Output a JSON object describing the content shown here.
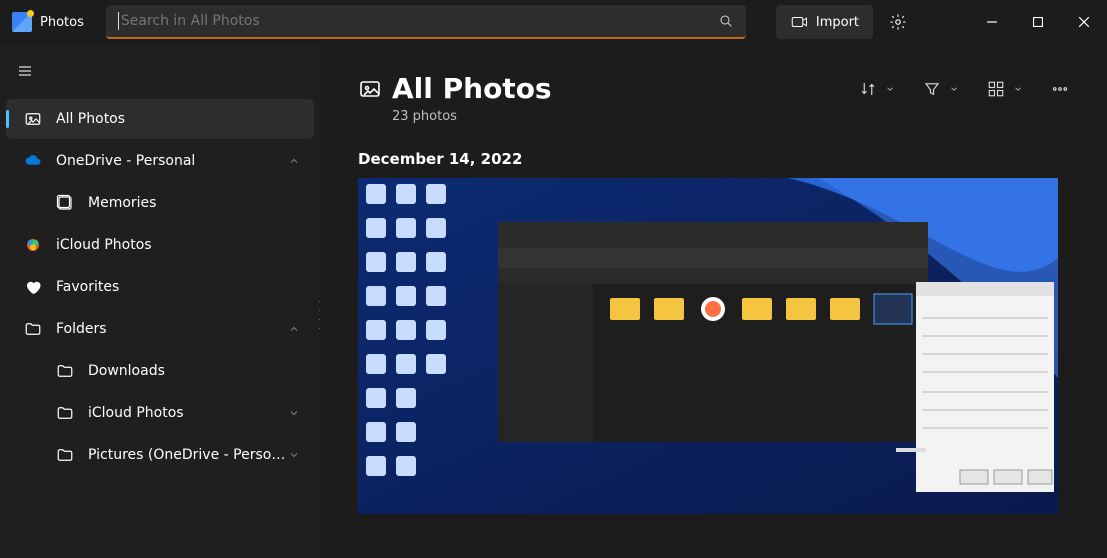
{
  "app": {
    "title": "Photos"
  },
  "search": {
    "placeholder": "Search in All Photos"
  },
  "toolbar": {
    "import_label": "Import"
  },
  "sidebar": {
    "all_photos": "All Photos",
    "onedrive": "OneDrive - Personal",
    "memories": "Memories",
    "icloud": "iCloud Photos",
    "favorites": "Favorites",
    "folders": "Folders",
    "downloads": "Downloads",
    "icloud_folder": "iCloud Photos",
    "pictures_od": "Pictures (OneDrive - Personal)"
  },
  "main": {
    "title": "All Photos",
    "count": "23 photos",
    "date1": "December 14, 2022"
  }
}
